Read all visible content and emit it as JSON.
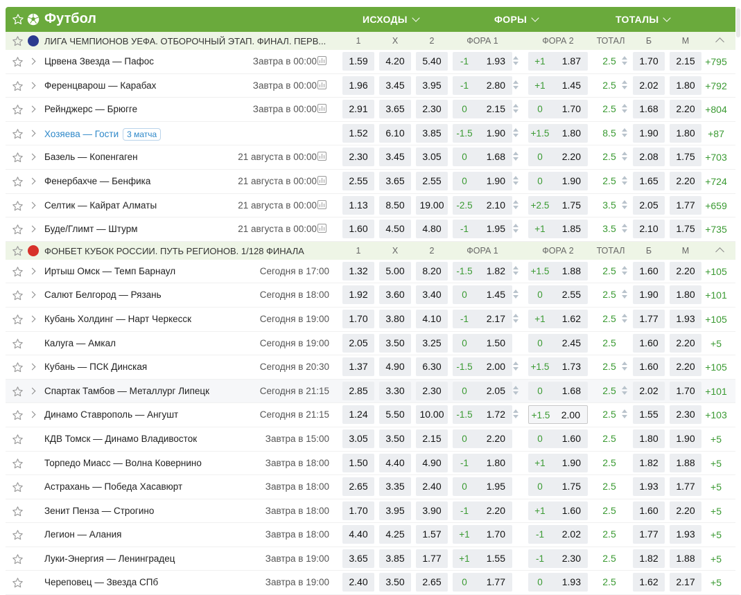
{
  "header": {
    "title": "Футбол",
    "col_outcomes": "ИСХОДЫ",
    "col_handicaps": "ФОРЫ",
    "col_totals": "ТОТАЛЫ",
    "brand_color": "#6aaa3c"
  },
  "columns": {
    "c1": "1",
    "cx": "X",
    "c2": "2",
    "f1": "ФОРА 1",
    "f2": "ФОРА 2",
    "total": "ТОТАЛ",
    "b": "Б",
    "m": "М"
  },
  "groups": [
    {
      "name": "ЛИГА ЧЕМПИОНОВ УЕФА. ОТБОРОЧНЫЙ ЭТАП. ФИНАЛ. ПЕРВ...",
      "icon": "champions-league-icon",
      "matches": [
        {
          "name": "Црвена Звезда — Пафос",
          "date": "Завтра в 00:00",
          "o1": "1.59",
          "ox": "4.20",
          "o2": "5.40",
          "h1": "-1",
          "f1": "1.93",
          "h2": "+1",
          "f2": "1.87",
          "t": "2.5",
          "b": "1.70",
          "m": "2.15",
          "more": "+795",
          "expand": true,
          "stat": true,
          "arrows": true,
          "alt": false
        },
        {
          "name": "Ференцварош — Карабах",
          "date": "Завтра в 00:00",
          "o1": "1.96",
          "ox": "3.45",
          "o2": "3.95",
          "h1": "-1",
          "f1": "2.80",
          "h2": "+1",
          "f2": "1.45",
          "t": "2.5",
          "b": "2.02",
          "m": "1.80",
          "more": "+792",
          "expand": true,
          "stat": true,
          "arrows": true,
          "alt": false
        },
        {
          "name": "Рейнджерс — Брюгге",
          "date": "Завтра в 00:00",
          "o1": "2.91",
          "ox": "3.65",
          "o2": "2.30",
          "h1": "0",
          "f1": "2.15",
          "h2": "0",
          "f2": "1.70",
          "t": "2.5",
          "b": "1.68",
          "m": "2.20",
          "more": "+804",
          "expand": true,
          "stat": true,
          "arrows": true,
          "alt": false
        },
        {
          "name": "Хозяева — Гости",
          "badge": "3 матча",
          "date": "",
          "o1": "1.52",
          "ox": "6.10",
          "o2": "3.85",
          "h1": "-1.5",
          "f1": "1.90",
          "h2": "+1.5",
          "f2": "1.80",
          "t": "8.5",
          "b": "1.90",
          "m": "1.80",
          "more": "+87",
          "expand": true,
          "stat": false,
          "arrows": true,
          "link": true,
          "alt": false
        },
        {
          "name": "Базель — Копенгаген",
          "date": "21 августа в 00:00",
          "o1": "2.30",
          "ox": "3.45",
          "o2": "3.05",
          "h1": "0",
          "f1": "1.68",
          "h2": "0",
          "f2": "2.20",
          "t": "2.5",
          "b": "2.08",
          "m": "1.75",
          "more": "+703",
          "expand": true,
          "stat": true,
          "arrows": true,
          "alt": false
        },
        {
          "name": "Фенербахче — Бенфика",
          "date": "21 августа в 00:00",
          "o1": "2.55",
          "ox": "3.65",
          "o2": "2.55",
          "h1": "0",
          "f1": "1.90",
          "h2": "0",
          "f2": "1.90",
          "t": "2.5",
          "b": "1.65",
          "m": "2.20",
          "more": "+724",
          "expand": true,
          "stat": true,
          "arrows": true,
          "alt": false
        },
        {
          "name": "Селтик — Кайрат Алматы",
          "date": "21 августа в 00:00",
          "o1": "1.13",
          "ox": "8.50",
          "o2": "19.00",
          "h1": "-2.5",
          "f1": "2.10",
          "h2": "+2.5",
          "f2": "1.75",
          "t": "3.5",
          "b": "2.05",
          "m": "1.77",
          "more": "+659",
          "expand": true,
          "stat": true,
          "arrows": true,
          "alt": false
        },
        {
          "name": "Буде/Глимт — Штурм",
          "date": "21 августа в 00:00",
          "o1": "1.60",
          "ox": "4.50",
          "o2": "4.80",
          "h1": "-1",
          "f1": "1.95",
          "h2": "+1",
          "f2": "1.85",
          "t": "3.5",
          "b": "2.10",
          "m": "1.75",
          "more": "+735",
          "expand": true,
          "stat": true,
          "arrows": true,
          "alt": false
        }
      ]
    },
    {
      "name": "ФОНБЕТ КУБОК РОССИИ. ПУТЬ РЕГИОНОВ. 1/128 ФИНАЛА",
      "icon": "russian-cup-icon",
      "matches": [
        {
          "name": "Иртыш Омск — Темп Барнаул",
          "date": "Сегодня в 17:00",
          "o1": "1.32",
          "ox": "5.00",
          "o2": "8.20",
          "h1": "-1.5",
          "f1": "1.82",
          "h2": "+1.5",
          "f2": "1.88",
          "t": "2.5",
          "b": "1.60",
          "m": "2.20",
          "more": "+105",
          "expand": true,
          "arrows": true,
          "alt": false
        },
        {
          "name": "Салют Белгород — Рязань",
          "date": "Сегодня в 18:00",
          "o1": "1.92",
          "ox": "3.60",
          "o2": "3.40",
          "h1": "0",
          "f1": "1.45",
          "h2": "0",
          "f2": "2.55",
          "t": "2.5",
          "b": "1.90",
          "m": "1.80",
          "more": "+101",
          "expand": true,
          "arrows": true,
          "alt": false
        },
        {
          "name": "Кубань Холдинг — Нарт Черкесск",
          "date": "Сегодня в 19:00",
          "o1": "1.70",
          "ox": "3.80",
          "o2": "4.10",
          "h1": "-1",
          "f1": "2.17",
          "h2": "+1",
          "f2": "1.62",
          "t": "2.5",
          "b": "1.77",
          "m": "1.93",
          "more": "+105",
          "expand": true,
          "arrows": true,
          "alt": false
        },
        {
          "name": "Калуга — Амкал",
          "date": "Сегодня в 19:00",
          "o1": "2.05",
          "ox": "3.50",
          "o2": "3.25",
          "h1": "0",
          "f1": "1.50",
          "h2": "0",
          "f2": "2.45",
          "t": "2.5",
          "b": "1.60",
          "m": "2.20",
          "more": "+5",
          "expand": false,
          "arrows": false,
          "alt": false
        },
        {
          "name": "Кубань — ПСК Динская",
          "date": "Сегодня в 20:30",
          "o1": "1.37",
          "ox": "4.90",
          "o2": "6.30",
          "h1": "-1.5",
          "f1": "2.00",
          "h2": "+1.5",
          "f2": "1.73",
          "t": "2.5",
          "b": "1.60",
          "m": "2.20",
          "more": "+105",
          "expand": true,
          "arrows": true,
          "alt": false
        },
        {
          "name": "Спартак Тамбов — Металлург Липецк",
          "date": "Сегодня в 21:15",
          "o1": "2.85",
          "ox": "3.30",
          "o2": "2.30",
          "h1": "0",
          "f1": "2.05",
          "h2": "0",
          "f2": "1.68",
          "t": "2.5",
          "b": "2.02",
          "m": "1.70",
          "more": "+101",
          "expand": true,
          "arrows": true,
          "alt": true
        },
        {
          "name": "Динамо Ставрополь — Ангушт",
          "date": "Сегодня в 21:15",
          "o1": "1.24",
          "ox": "5.50",
          "o2": "10.00",
          "h1": "-1.5",
          "f1": "1.72",
          "h2": "+1.5",
          "f2": "2.00",
          "t": "2.5",
          "b": "1.55",
          "m": "2.30",
          "more": "+103",
          "expand": true,
          "arrows": true,
          "sel": true,
          "alt": false
        },
        {
          "name": "КДВ Томск — Динамо Владивосток",
          "date": "Завтра в 15:00",
          "o1": "3.05",
          "ox": "3.50",
          "o2": "2.15",
          "h1": "0",
          "f1": "2.20",
          "h2": "0",
          "f2": "1.60",
          "t": "2.5",
          "b": "1.80",
          "m": "1.90",
          "more": "+5",
          "expand": false,
          "arrows": false,
          "alt": false
        },
        {
          "name": "Торпедо Миасс — Волна Ковернино",
          "date": "Завтра в 18:00",
          "o1": "1.50",
          "ox": "4.40",
          "o2": "4.90",
          "h1": "-1",
          "f1": "1.80",
          "h2": "+1",
          "f2": "1.90",
          "t": "2.5",
          "b": "1.82",
          "m": "1.88",
          "more": "+5",
          "expand": false,
          "arrows": false,
          "alt": false
        },
        {
          "name": "Астрахань — Победа Хасавюрт",
          "date": "Завтра в 18:00",
          "o1": "2.65",
          "ox": "3.35",
          "o2": "2.40",
          "h1": "0",
          "f1": "1.95",
          "h2": "0",
          "f2": "1.75",
          "t": "2.5",
          "b": "1.93",
          "m": "1.77",
          "more": "+5",
          "expand": false,
          "arrows": false,
          "alt": false
        },
        {
          "name": "Зенит Пенза — Строгино",
          "date": "Завтра в 18:00",
          "o1": "1.70",
          "ox": "3.95",
          "o2": "3.90",
          "h1": "-1",
          "f1": "2.20",
          "h2": "+1",
          "f2": "1.60",
          "t": "2.5",
          "b": "1.60",
          "m": "2.20",
          "more": "+5",
          "expand": false,
          "arrows": false,
          "alt": false
        },
        {
          "name": "Легион — Алания",
          "date": "Завтра в 18:00",
          "o1": "4.40",
          "ox": "4.25",
          "o2": "1.57",
          "h1": "+1",
          "f1": "1.70",
          "h2": "-1",
          "f2": "2.02",
          "t": "2.5",
          "b": "1.77",
          "m": "1.93",
          "more": "+5",
          "expand": false,
          "arrows": false,
          "alt": false
        },
        {
          "name": "Луки-Энергия — Ленинградец",
          "date": "Завтра в 19:00",
          "o1": "3.65",
          "ox": "3.85",
          "o2": "1.77",
          "h1": "+1",
          "f1": "1.55",
          "h2": "-1",
          "f2": "2.30",
          "t": "2.5",
          "b": "1.82",
          "m": "1.88",
          "more": "+5",
          "expand": false,
          "arrows": false,
          "alt": false
        },
        {
          "name": "Череповец — Звезда СПб",
          "date": "Завтра в 19:00",
          "o1": "2.40",
          "ox": "3.50",
          "o2": "2.65",
          "h1": "0",
          "f1": "1.77",
          "h2": "0",
          "f2": "1.93",
          "t": "2.5",
          "b": "1.62",
          "m": "2.17",
          "more": "+5",
          "expand": false,
          "arrows": false,
          "alt": false
        }
      ]
    }
  ]
}
